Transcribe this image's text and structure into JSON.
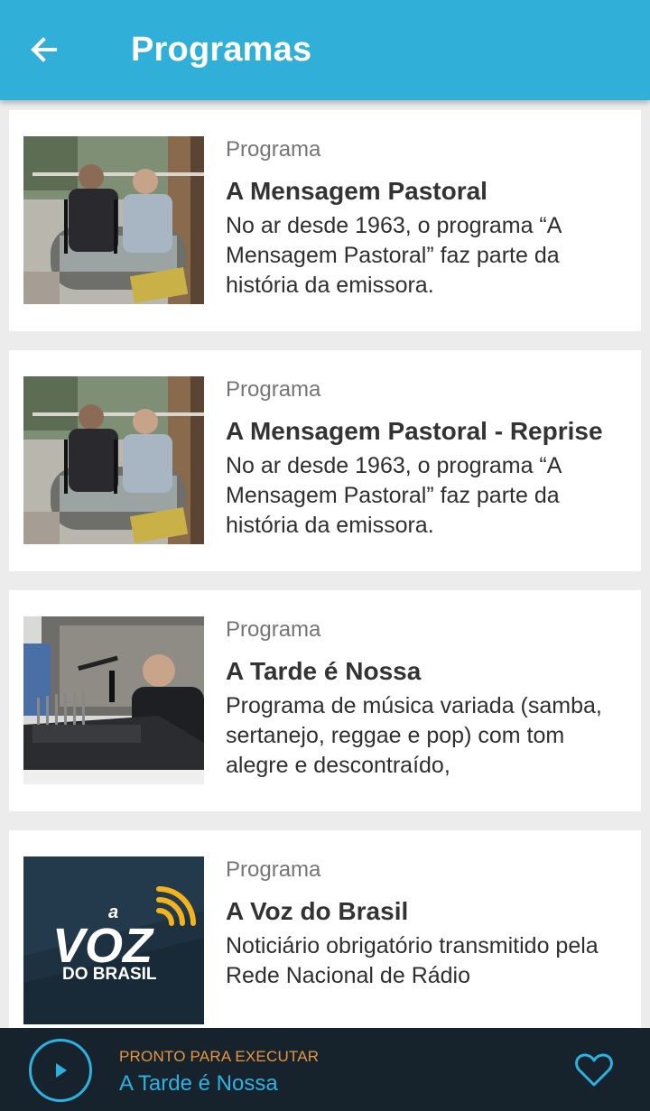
{
  "appbar": {
    "title": "Programas",
    "back_icon": "arrow-left-icon",
    "color": "#30b0d9"
  },
  "programs": [
    {
      "kicker": "Programa",
      "title": "A Mensagem Pastoral",
      "description": "No ar desde 1963, o programa “A Mensagem Pastoral” faz parte da história da emissora.",
      "thumbnail": "studio-two-hosts-photo"
    },
    {
      "kicker": "Programa",
      "title": "A Mensagem Pastoral - Reprise",
      "description": "No ar desde 1963, o programa “A Mensagem Pastoral” faz parte da história da emissora.",
      "thumbnail": "studio-two-hosts-photo"
    },
    {
      "kicker": "Programa",
      "title": "A Tarde é Nossa",
      "description": "Programa de música variada (samba, sertanejo, reggae e pop) com tom alegre e descontraído,",
      "thumbnail": "studio-host-mixer-photo"
    },
    {
      "kicker": "Programa",
      "title": "A Voz do Brasil",
      "description": "Noticiário obrigatório transmitido pela Rede Nacional de Rádio",
      "thumbnail": "voz-do-brasil-logo",
      "logo_text": {
        "small": "a",
        "big": "VOZ",
        "bottom": "DO BRASIL"
      }
    }
  ],
  "player": {
    "status": "PRONTO PARA EXECUTAR",
    "track": "A Tarde é Nossa",
    "play_icon": "play-icon",
    "favorite_icon": "heart-outline-icon",
    "accent_color": "#2db1e0",
    "status_color": "#e69540"
  }
}
